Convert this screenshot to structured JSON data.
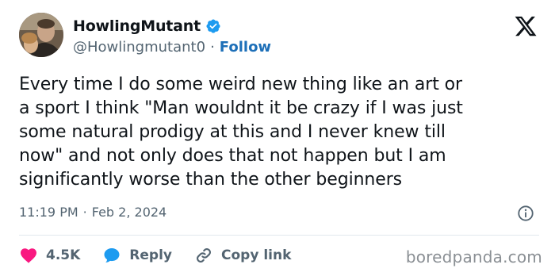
{
  "author": {
    "display_name": "HowlingMutant",
    "handle": "@Howlingmutant0",
    "separator": "·",
    "follow_label": "Follow",
    "verified_color": "#1d9bf0"
  },
  "tweet": {
    "text": "Every time I do some weird new thing like an art or\na sport I think \"Man wouldnt it be crazy if I was just\nsome natural prodigy at this and I never knew till\nnow\" and not only does that not happen but I am\nsignificantly worse than the other beginners",
    "time": "11:19 PM",
    "separator": "·",
    "date": "Feb 2, 2024"
  },
  "actions": {
    "like_count": "4.5K",
    "reply_label": "Reply",
    "copy_link_label": "Copy link",
    "like_color": "#f91880",
    "reply_color": "#1d9bf0"
  },
  "watermark": {
    "text": "boredpanda.com"
  },
  "icons": {
    "platform_logo": "x-logo-icon",
    "info": "info-icon",
    "like": "heart-icon",
    "reply": "speech-bubble-icon",
    "copy_link": "link-icon",
    "verified": "verified-badge-icon"
  }
}
